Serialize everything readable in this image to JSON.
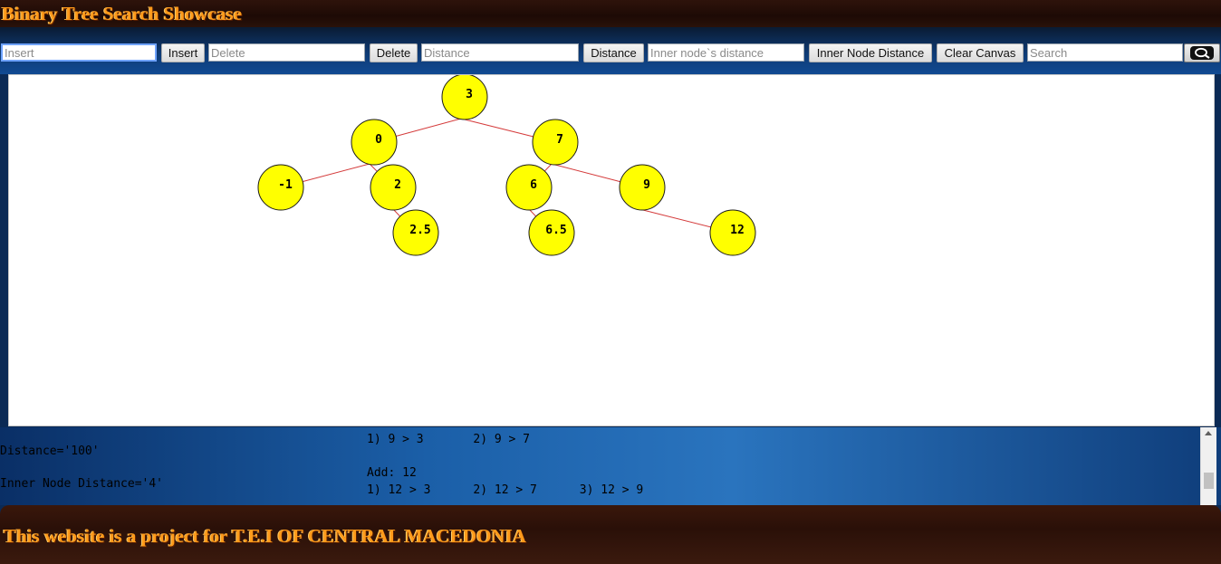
{
  "header": {
    "title": "Binary Tree Search Showcase"
  },
  "toolbar": {
    "insert_placeholder": "Insert",
    "insert_label": "Insert",
    "delete_placeholder": "Delete",
    "delete_label": "Delete",
    "distance_placeholder": "Distance",
    "distance_label": "Distance",
    "inner_placeholder": "Inner node`s distance",
    "inner_label": "Inner Node Distance",
    "clear_label": "Clear Canvas",
    "search_placeholder": "Search",
    "search_icon": "search-icon"
  },
  "tree": {
    "node_color": "#ffff00",
    "edge_color": "#d43a3a",
    "nodes": [
      {
        "id": "3",
        "label": "3",
        "parent": null
      },
      {
        "id": "0",
        "label": "0",
        "parent": "3"
      },
      {
        "id": "7",
        "label": "7",
        "parent": "3"
      },
      {
        "id": "-1",
        "label": "-1",
        "parent": "0"
      },
      {
        "id": "2",
        "label": "2",
        "parent": "0"
      },
      {
        "id": "2.5",
        "label": "2.5",
        "parent": "2"
      },
      {
        "id": "6",
        "label": "6",
        "parent": "7"
      },
      {
        "id": "6.5",
        "label": "6.5",
        "parent": "6"
      },
      {
        "id": "9",
        "label": "9",
        "parent": "7"
      },
      {
        "id": "12",
        "label": "12",
        "parent": "9"
      }
    ]
  },
  "output": {
    "distance": "Distance='100'",
    "inner_distance": "Inner Node Distance='4'",
    "log": [
      "1) 9 > 3       2) 9 > 7",
      "",
      "Add: 12",
      "1) 12 > 3      2) 12 > 7      3) 12 > 9"
    ]
  },
  "footer": {
    "text": "This website is a project for T.E.I OF CENTRAL MACEDONIA"
  }
}
